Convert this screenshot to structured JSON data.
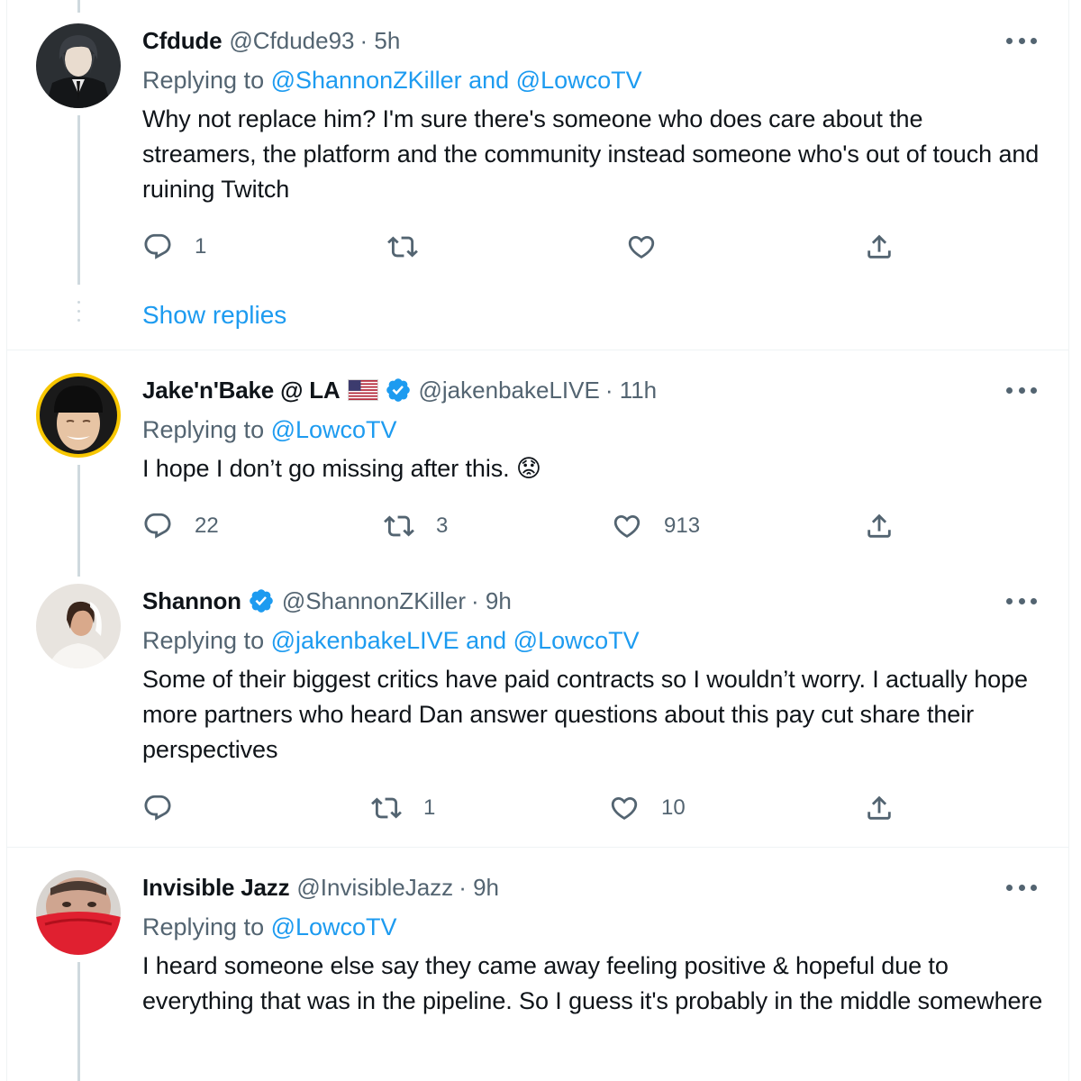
{
  "tweets": [
    {
      "name": "Cfdude",
      "handle": "@Cfdude93",
      "time": "· 5h",
      "replying_prefix": "Replying to ",
      "mentions": "@ShannonZKiller and @LowcoTV",
      "text": "Why not replace him? I'm sure there's someone who does care about the streamers, the platform and the community instead someone who's out of touch and ruining Twitch",
      "reply_count": "1",
      "retweet_count": "",
      "like_count": "",
      "show_replies": "Show replies"
    },
    {
      "name": "Jake'n'Bake @ LA",
      "handle": "@jakenbakeLIVE",
      "time": "· 11h",
      "replying_prefix": "Replying to ",
      "mentions": "@LowcoTV",
      "text": "I hope I don’t go missing after this. 😟",
      "reply_count": "22",
      "retweet_count": "3",
      "like_count": "913"
    },
    {
      "name": "Shannon",
      "handle": "@ShannonZKiller",
      "time": "· 9h",
      "replying_prefix": "Replying to ",
      "mentions": "@jakenbakeLIVE and @LowcoTV",
      "text": "Some of their biggest critics have paid contracts so I wouldn’t worry. I actually hope more partners who heard Dan answer questions about this pay cut share their perspectives",
      "reply_count": "",
      "retweet_count": "1",
      "like_count": "10"
    },
    {
      "name": "Invisible Jazz",
      "handle": "@InvisibleJazz",
      "time": "· 9h",
      "replying_prefix": "Replying to ",
      "mentions": "@LowcoTV",
      "text": "I heard someone else say they came away feeling positive & hopeful due to everything that was in the pipeline.  So I guess it's probably in the middle somewhere"
    }
  ],
  "colors": {
    "link": "#1d9bf0",
    "secondary_text": "#536471",
    "primary_text": "#0f1419",
    "thread_line": "#cfd9de",
    "verified": "#1d9bf0"
  },
  "icons": [
    "reply-icon",
    "retweet-icon",
    "like-icon",
    "share-icon",
    "more-icon",
    "verified-badge-icon",
    "us-flag-icon"
  ]
}
